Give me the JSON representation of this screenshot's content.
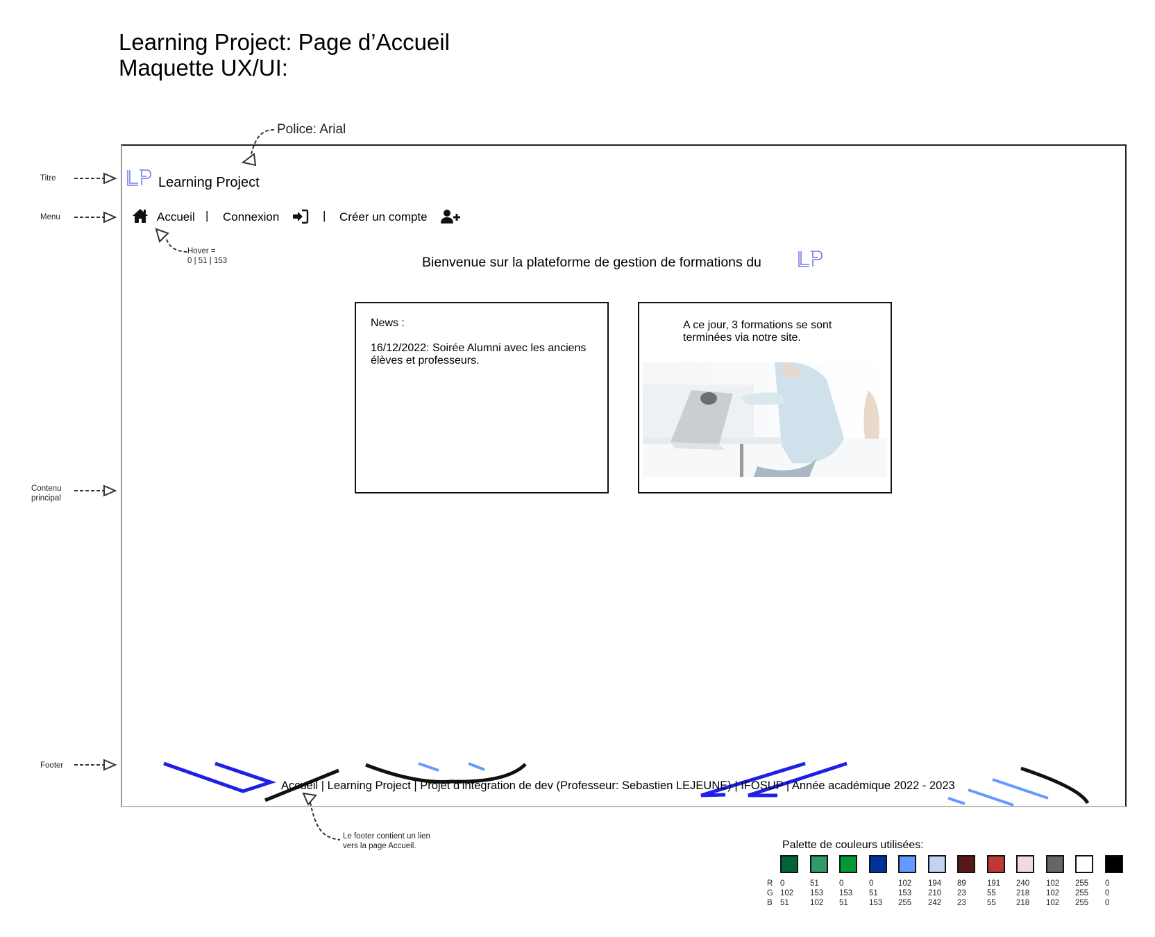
{
  "header": {
    "title_line1": "Learning Project: Page d’Accueil",
    "title_line2": "Maquette UX/UI:"
  },
  "annotations": {
    "police": "Police: Arial",
    "hover_line1": "Hover =",
    "hover_line2": "0 | 51 | 153",
    "footer_note_line1": "Le footer contient un lien",
    "footer_note_line2": "vers la page Accueil."
  },
  "side_labels": {
    "titre": "Titre",
    "menu": "Menu",
    "contenu_line1": "Contenu",
    "contenu_line2": "principal",
    "footer": "Footer"
  },
  "mockup": {
    "logo_text": "LP",
    "site_title": "Learning Project",
    "menu": {
      "home_icon": "home-icon",
      "accueil": "Accueil",
      "sep1": "|",
      "connexion": "Connexion",
      "login_icon": "login-icon",
      "sep2": "|",
      "creer": "Créer un compte",
      "user_plus_icon": "user-plus-icon"
    },
    "welcome": "Bienvenue sur la plateforme de gestion de formations du",
    "news_card": {
      "heading": "News :",
      "text": "16/12/2022: Soirée Alumni avec les anciens élèves et professeurs."
    },
    "stats_card": {
      "text": "A ce jour, 3 formations se sont terminées via notre site."
    },
    "footer": "Accueil | Learning Project | Projet d’intégration de dev (Professeur: Sebastien LEJEUNE) | IFOSUP | Année académique 2022 - 2023"
  },
  "palette": {
    "title": "Palette de couleurs utilisées:",
    "row_labels": [
      "R",
      "G",
      "B"
    ],
    "colors": [
      {
        "hex": "#006633",
        "r": "0",
        "g": "102",
        "b": "51"
      },
      {
        "hex": "#339966",
        "r": "51",
        "g": "153",
        "b": "102"
      },
      {
        "hex": "#009933",
        "r": "0",
        "g": "153",
        "b": "51"
      },
      {
        "hex": "#003399",
        "r": "0",
        "g": "51",
        "b": "153"
      },
      {
        "hex": "#6699FF",
        "r": "102",
        "g": "153",
        "b": "255"
      },
      {
        "hex": "#C2D2F2",
        "r": "194",
        "g": "210",
        "b": "242"
      },
      {
        "hex": "#591717",
        "r": "89",
        "g": "23",
        "b": "23"
      },
      {
        "hex": "#BF3737",
        "r": "191",
        "g": "55",
        "b": "55"
      },
      {
        "hex": "#F0DADA",
        "r": "240",
        "g": "218",
        "b": "218"
      },
      {
        "hex": "#666666",
        "r": "102",
        "g": "102",
        "b": "102"
      },
      {
        "hex": "#FFFFFF",
        "r": "255",
        "g": "255",
        "b": "255"
      },
      {
        "hex": "#000000",
        "r": "0",
        "g": "0",
        "b": "0"
      }
    ]
  }
}
